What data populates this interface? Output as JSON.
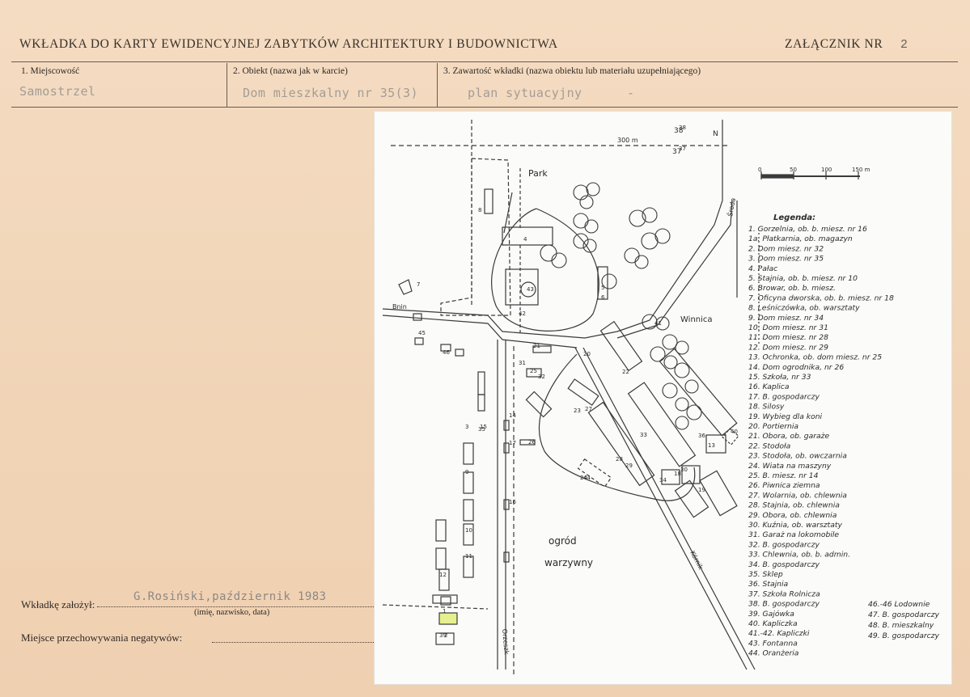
{
  "header": {
    "title": "WKŁADKA DO KARTY EWIDENCYJNEJ ZABYTKÓW  ARCHITEKTURY I BUDOWNICTWA",
    "annex_label": "ZAŁĄCZNIK NR",
    "annex_number": "2"
  },
  "fields": {
    "place_label": "1.  Miejscowość",
    "place_value": "Samostrzel",
    "object_label": "2.  Obiekt  (nazwa jak w karcie)",
    "object_value": "Dom mieszkalny nr 35(3)",
    "content_label": "3.  Zawartość  wkładki  (nazwa obiektu lub materiału uzupełniającego)",
    "content_value": "plan sytuacyjny",
    "content_dash": "-"
  },
  "footer": {
    "founded_label": "Wkładkę  założył:",
    "founded_value": "G.Rosiński,październik 1983",
    "founded_hint": "(imię, nazwisko, data)",
    "storage_label": "Miejsce przechowywania negatywów:"
  },
  "plan": {
    "park": "Park",
    "vineyard": "Winnica",
    "garden_1": "ogród",
    "garden_2": "warzywny",
    "road_west": "Bnin",
    "road_east": "Środa",
    "road_south": "Orzeszk",
    "road_southeast": "Kórnik",
    "ref_300": "300 m",
    "ref_37": "37",
    "ref_38": "38",
    "north": "N",
    "scale_ticks": [
      "0",
      "50",
      "100",
      "150 m"
    ],
    "numbers": [
      "1",
      "2",
      "3",
      "4",
      "5",
      "6",
      "7",
      "8",
      "9",
      "10",
      "11",
      "12",
      "13",
      "14",
      "15",
      "16",
      "17",
      "18",
      "19",
      "20",
      "21",
      "22",
      "23",
      "24",
      "25",
      "26",
      "27",
      "28",
      "29",
      "30",
      "31",
      "32",
      "33",
      "34",
      "35",
      "36",
      "37",
      "38",
      "39",
      "40",
      "41",
      "42",
      "43",
      "44",
      "45",
      "46"
    ],
    "legend_title": "Legenda:",
    "legend_left": [
      "1. Gorzelnia, ob. b. miesz. nr 16",
      "1a. Płatkarnia, ob. magazyn",
      "2. Dom miesz. nr 32",
      "3. Dom miesz. nr 35",
      "4. Pałac",
      "5. Stajnia, ob. b. miesz. nr 10",
      "6. Browar, ob. b. miesz.",
      "7. Oficyna dworska, ob. b. miesz. nr 18",
      "8. Leśniczówka, ob. warsztaty",
      "9. Dom miesz. nr 34",
      "10. Dom miesz. nr 31",
      "11. Dom miesz. nr 28",
      "12. Dom miesz. nr 29",
      "13. Ochronka, ob. dom miesz. nr 25",
      "14. Dom ogrodnika, nr 26",
      "15. Szkoła, nr 33",
      "16. Kaplica",
      "17. B. gospodarczy",
      "18. Silosy",
      "19. Wybieg dla koni",
      "20. Portiernia",
      "21. Obora, ob. garaże",
      "22. Stodoła",
      "23. Stodoła, ob. owczarnia",
      "24. Wiata na maszyny",
      "25. B. miesz. nr 14",
      "26. Piwnica ziemna",
      "27. Wolarnia, ob. chlewnia",
      "28. Stajnia, ob. chlewnia",
      "29. Obora, ob. chlewnia",
      "30. Kuźnia, ob. warsztaty",
      "31. Garaż na lokomobile",
      "32. B. gospodarczy",
      "33. Chlewnia, ob. b. admin.",
      "34. B. gospodarczy",
      "35. Sklep",
      "36. Stajnia",
      "37. Szkoła Rolnicza",
      "38. B. gospodarczy",
      "39. Gajówka",
      "40. Kapliczka",
      "41.-42. Kapliczki",
      "43. Fontanna",
      "44. Oranżeria"
    ],
    "legend_right": [
      "46.-46 Lodownie",
      "47. B. gospodarczy",
      "48. B. mieszkalny",
      "49. B. gospodarczy"
    ]
  }
}
